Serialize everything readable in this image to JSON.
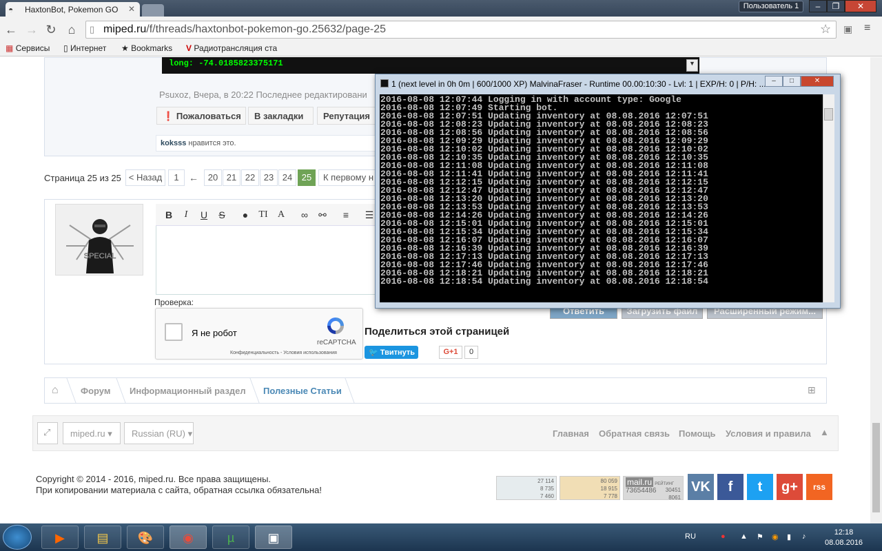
{
  "browser": {
    "tab_title": "HaxtonBot, Pokemon GO",
    "user_button": "Пользователь 1",
    "url_domain": "miped.ru",
    "url_path": "/f/threads/haxtonbot-pokemon-go.25632/page-25",
    "bookmarks": [
      "Сервисы",
      "Интернет",
      "Bookmarks",
      "Радиотрансляция ста"
    ]
  },
  "post": {
    "code_line": "long: -74.0185823375171",
    "meta": "Psuxoz, Вчера, в 20:22  Последнее редактировани",
    "buttons": [
      "Пожаловаться",
      "В закладки",
      "Репутация"
    ],
    "likes_user": "koksss",
    "likes_text": " нравится это."
  },
  "pager": {
    "label": "Страница 25 из 25",
    "prev": "< Назад",
    "first": "1",
    "arrow": "←",
    "pages": [
      "20",
      "21",
      "22",
      "23",
      "24",
      "25"
    ],
    "to_first": "К первому н"
  },
  "reply": {
    "avatar_text": "SPECIAL",
    "check_label": "Проверка:",
    "captcha_text": "Я не робот",
    "captcha_brand": "reCAPTCHA",
    "captcha_links": "Конфиденциальность - Условия использования",
    "buttons": [
      "Ответить",
      "Загрузить файл",
      "Расширенный режим..."
    ]
  },
  "share": {
    "title": "Поделиться этой страницей",
    "tweet": "Твитнуть",
    "gplus": "G+1",
    "gplus_count": "0"
  },
  "breadcrumb": [
    "Форум",
    "Информационный раздел",
    "Полезные Статьи"
  ],
  "footer": {
    "site_select": "miped.ru",
    "lang_select": "Russian (RU)",
    "links": [
      "Главная",
      "Обратная связь",
      "Помощь",
      "Условия и правила"
    ],
    "copyright_1": "Copyright © 2014 - 2016, miped.ru. Все права защищены.",
    "copyright_2": "При копировании материала с сайта, обратная ссылка обязательна!",
    "counter1": [
      "27 114",
      "8 735",
      "7 460"
    ],
    "counter2": [
      "80 059",
      "18 915",
      "7 778"
    ],
    "mailru": [
      "mail.ru",
      "РЕЙТИНГ",
      "73654486",
      "30451",
      "8061"
    ],
    "social": [
      "VK",
      "f",
      "t",
      "g+",
      "rss"
    ]
  },
  "console": {
    "title": "1 (next level in 0h 0m | 600/1000 XP) MalvinaFraser - Runtime 00.00:10:30 - Lvl: 1 | EXP/H: 0 | P/H: ...",
    "lines": [
      "2016-08-08 12:07:44 Logging in with account type: Google",
      "2016-08-08 12:07:49 Starting bot.",
      "2016-08-08 12:07:51 Updating inventory at 08.08.2016 12:07:51",
      "2016-08-08 12:08:23 Updating inventory at 08.08.2016 12:08:23",
      "2016-08-08 12:08:56 Updating inventory at 08.08.2016 12:08:56",
      "2016-08-08 12:09:29 Updating inventory at 08.08.2016 12:09:29",
      "2016-08-08 12:10:02 Updating inventory at 08.08.2016 12:10:02",
      "2016-08-08 12:10:35 Updating inventory at 08.08.2016 12:10:35",
      "2016-08-08 12:11:08 Updating inventory at 08.08.2016 12:11:08",
      "2016-08-08 12:11:41 Updating inventory at 08.08.2016 12:11:41",
      "2016-08-08 12:12:15 Updating inventory at 08.08.2016 12:12:15",
      "2016-08-08 12:12:47 Updating inventory at 08.08.2016 12:12:47",
      "2016-08-08 12:13:20 Updating inventory at 08.08.2016 12:13:20",
      "2016-08-08 12:13:53 Updating inventory at 08.08.2016 12:13:53",
      "2016-08-08 12:14:26 Updating inventory at 08.08.2016 12:14:26",
      "2016-08-08 12:15:01 Updating inventory at 08.08.2016 12:15:01",
      "2016-08-08 12:15:34 Updating inventory at 08.08.2016 12:15:34",
      "2016-08-08 12:16:07 Updating inventory at 08.08.2016 12:16:07",
      "2016-08-08 12:16:39 Updating inventory at 08.08.2016 12:16:39",
      "2016-08-08 12:17:13 Updating inventory at 08.08.2016 12:17:13",
      "2016-08-08 12:17:46 Updating inventory at 08.08.2016 12:17:46",
      "2016-08-08 12:18:21 Updating inventory at 08.08.2016 12:18:21",
      "2016-08-08 12:18:54 Updating inventory at 08.08.2016 12:18:54"
    ]
  },
  "taskbar": {
    "lang": "RU",
    "time": "12:18",
    "date": "08.08.2016"
  },
  "colors": {
    "accent_green": "#6fa356",
    "link_blue": "#4a88b5",
    "tweet_blue": "#1b95e0"
  }
}
